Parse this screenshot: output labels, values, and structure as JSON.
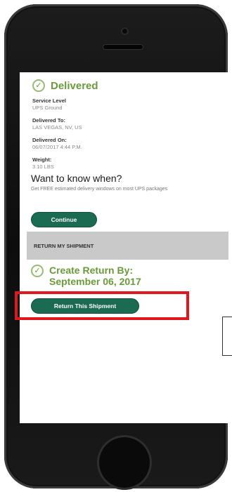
{
  "delivery": {
    "status": "Delivered",
    "service_level_label": "Service Level",
    "service_level_value": "UPS Ground",
    "delivered_to_label": "Delivered To:",
    "delivered_to_value": "LAS VEGAS, NV, US",
    "delivered_on_label": "Delivered On:",
    "delivered_on_value": "06/07/2017 4:44 P.M.",
    "weight_label": "Weight:",
    "weight_value": "3.10 LBS"
  },
  "promo": {
    "title": "Want to know when?",
    "subtitle": "Get FREE estimated delivery windows on most UPS packages",
    "continue_label": "Continue"
  },
  "return": {
    "section_label": "RETURN MY SHIPMENT",
    "create_return_line1": "Create Return By:",
    "create_return_line2": "September 06, 2017",
    "return_button_label": "Return This Shipment"
  },
  "colors": {
    "green_text": "#6a9a3a",
    "button_green": "#1b6a52",
    "highlight_red": "#e0181d"
  }
}
